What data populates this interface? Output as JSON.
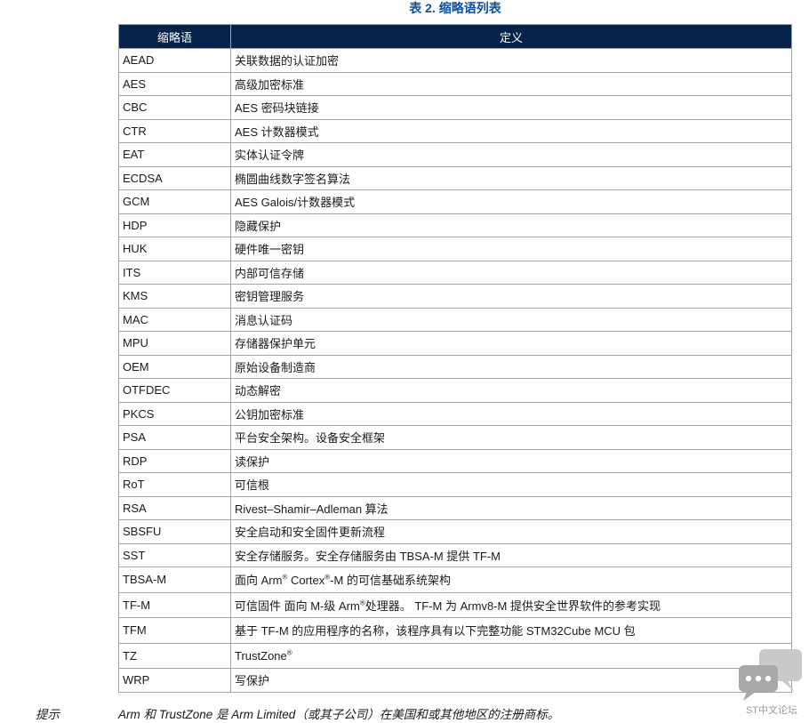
{
  "table": {
    "caption": "表 2. 缩略语列表",
    "headers": [
      "缩略语",
      "定义"
    ],
    "rows": [
      {
        "abbr": "AEAD",
        "def": "关联数据的认证加密"
      },
      {
        "abbr": "AES",
        "def": "高级加密标准"
      },
      {
        "abbr": "CBC",
        "def": "AES 密码块链接"
      },
      {
        "abbr": "CTR",
        "def": "AES 计数器模式"
      },
      {
        "abbr": "EAT",
        "def": "实体认证令牌"
      },
      {
        "abbr": "ECDSA",
        "def": "椭圆曲线数字签名算法"
      },
      {
        "abbr": "GCM",
        "def": "AES Galois/计数器模式"
      },
      {
        "abbr": "HDP",
        "def": "隐藏保护"
      },
      {
        "abbr": "HUK",
        "def": "硬件唯一密钥"
      },
      {
        "abbr": "ITS",
        "def": "内部可信存储"
      },
      {
        "abbr": "KMS",
        "def": "密钥管理服务"
      },
      {
        "abbr": "MAC",
        "def": "消息认证码"
      },
      {
        "abbr": "MPU",
        "def": "存储器保护单元"
      },
      {
        "abbr": "OEM",
        "def": "原始设备制造商"
      },
      {
        "abbr": "OTFDEC",
        "def": "动态解密"
      },
      {
        "abbr": "PKCS",
        "def": "公钥加密标准"
      },
      {
        "abbr": "PSA",
        "def": "平台安全架构。设备安全框架"
      },
      {
        "abbr": "RDP",
        "def": "读保护"
      },
      {
        "abbr": "RoT",
        "def": "可信根"
      },
      {
        "abbr": "RSA",
        "def": "Rivest–Shamir–Adleman 算法"
      },
      {
        "abbr": "SBSFU",
        "def": "安全启动和安全固件更新流程"
      },
      {
        "abbr": "SST",
        "def": "安全存储服务。安全存储服务由 TBSA-M 提供 TF-M"
      }
    ],
    "tbsa": {
      "abbr": "TBSA-M",
      "def_a": "面向 Arm",
      "reg1": "®",
      "def_b": " Cortex",
      "reg2": "®",
      "def_c": "-M 的可信基础系统架构"
    },
    "tfm": {
      "abbr": "TF-M",
      "def_a": "可信固件 面向 M-级 Arm",
      "reg": "®",
      "def_b": "处理器。 TF-M 为 Armv8-M 提供安全世界软件的参考实现"
    },
    "tfm2": {
      "abbr": "TFM",
      "def": "基于 TF-M 的应用程序的名称，该程序具有以下完整功能 STM32Cube MCU 包"
    },
    "tz": {
      "abbr": "TZ",
      "def_a": "TrustZone",
      "reg": "®"
    },
    "wrp": {
      "abbr": "WRP",
      "def": "写保护"
    }
  },
  "note": {
    "label": "提示",
    "text": "Arm 和 TrustZone 是 Arm Limited（或其子公司）在美国和或其他地区的注册商标。"
  },
  "watermark": {
    "text": "ST中文论坛",
    "icon": "chat-bubbles-icon"
  }
}
